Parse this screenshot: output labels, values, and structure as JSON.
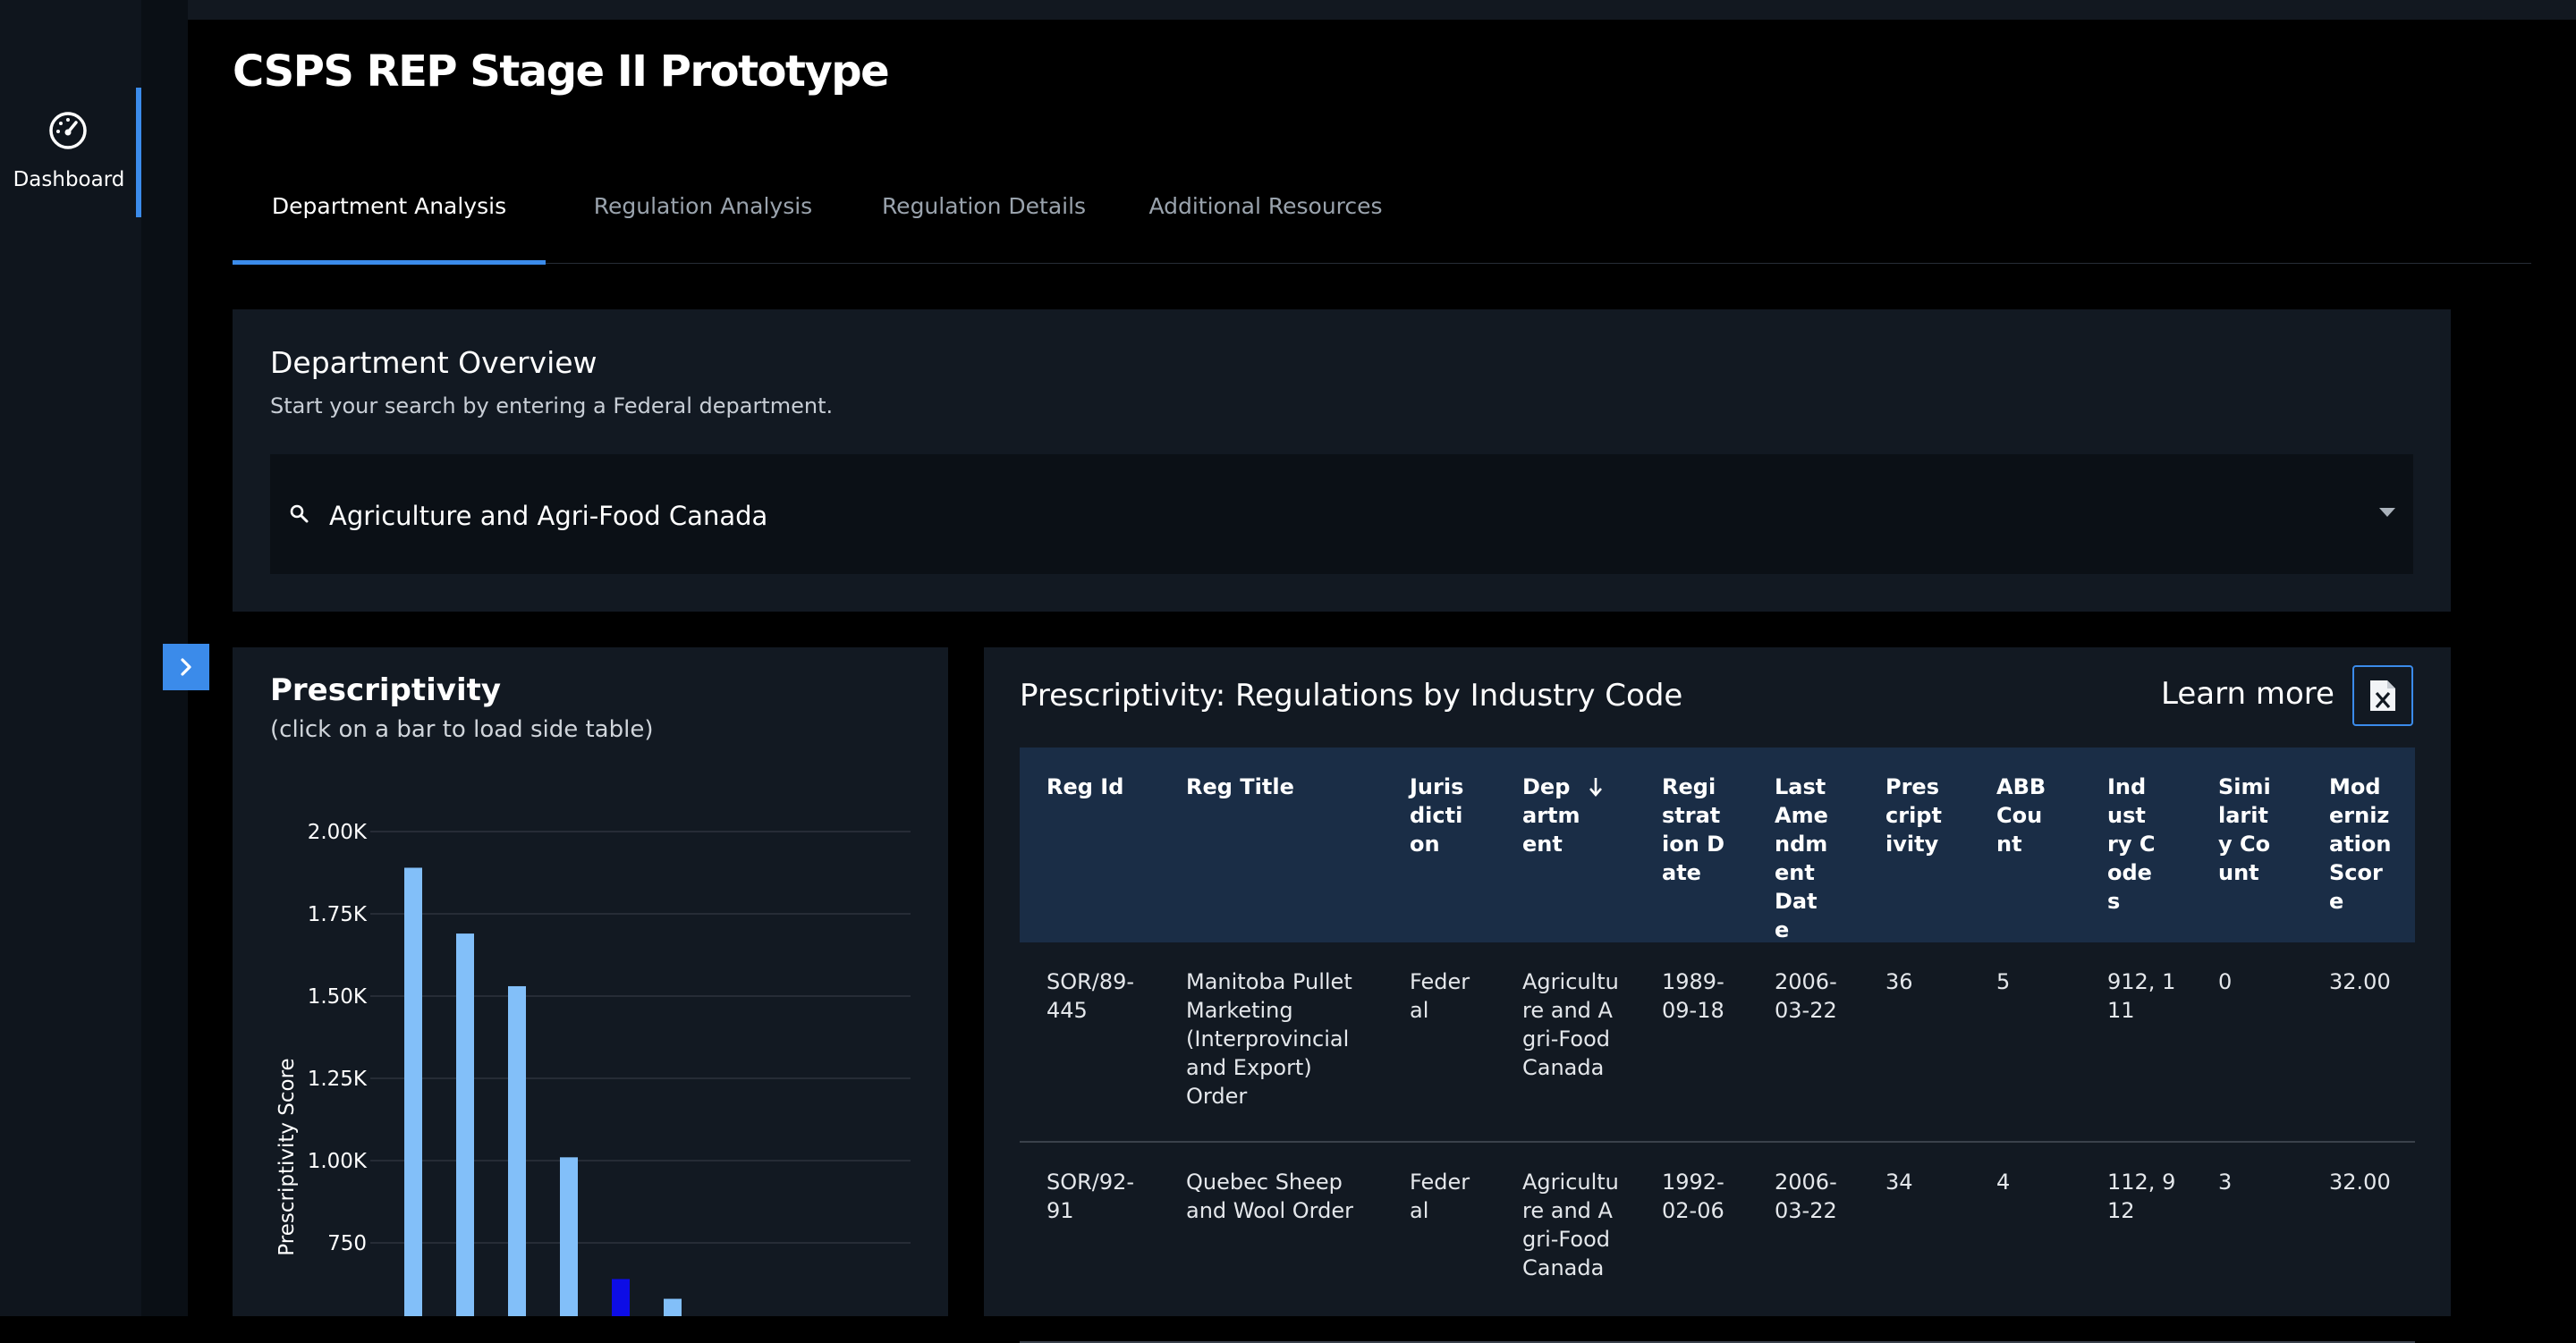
{
  "sidebar": {
    "nav_label": "Dashboard"
  },
  "header": {
    "title": "CSPS REP Stage II Prototype"
  },
  "tabs": [
    {
      "label": "Department Analysis"
    },
    {
      "label": "Regulation Analysis"
    },
    {
      "label": "Regulation Details"
    },
    {
      "label": "Additional Resources"
    }
  ],
  "overview": {
    "title": "Department Overview",
    "subtitle": "Start your search by entering a Federal department.",
    "selected_department": "Agriculture and Agri-Food Canada"
  },
  "chart": {
    "title": "Prescriptivity",
    "subtitle": "(click on a bar to load side table)"
  },
  "chart_data": {
    "type": "bar",
    "ylabel": "Prescriptivity Score",
    "xlabel": "",
    "yticks": [
      "750",
      "1.00K",
      "1.25K",
      "1.50K",
      "1.75K",
      "2.00K"
    ],
    "ytick_values": [
      750,
      1000,
      1250,
      1500,
      1750,
      2000
    ],
    "ylim_visible": [
      530,
      2000
    ],
    "values": [
      1890,
      1690,
      1530,
      1010,
      640,
      580
    ],
    "selected_index": 4,
    "colors": {
      "bar": "#82bff9",
      "selected": "#0d0de6",
      "grid": "#2c333c"
    }
  },
  "table": {
    "title": "Prescriptivity: Regulations by Industry Code",
    "learn_more": "Learn more",
    "columns": [
      "Reg Id",
      "Reg Title",
      "Jurisdiction",
      "Department",
      "Registration Date",
      "Last Amendment Date",
      "Prescriptivity",
      "ABB Count",
      "Industry Codes",
      "Similarity Count",
      "Modernization Score"
    ],
    "rows": [
      [
        "SOR/89-445",
        "Manitoba Pullet Marketing (Interprovincial and Export) Order",
        "Federal",
        "Agriculture and Agri-Food Canada",
        "1989-09-18",
        "2006-03-22",
        "36",
        "5",
        "912, 111",
        "0",
        "32.00"
      ],
      [
        "SOR/92-91",
        "Quebec Sheep and Wool Order",
        "Federal",
        "Agriculture and Agri-Food Canada",
        "1992-02-06",
        "2006-03-22",
        "34",
        "4",
        "112, 912",
        "3",
        "32.00"
      ]
    ]
  },
  "colors": {
    "accent": "#3b8bea",
    "panel": "#121922",
    "header_row": "#1a2d46"
  }
}
